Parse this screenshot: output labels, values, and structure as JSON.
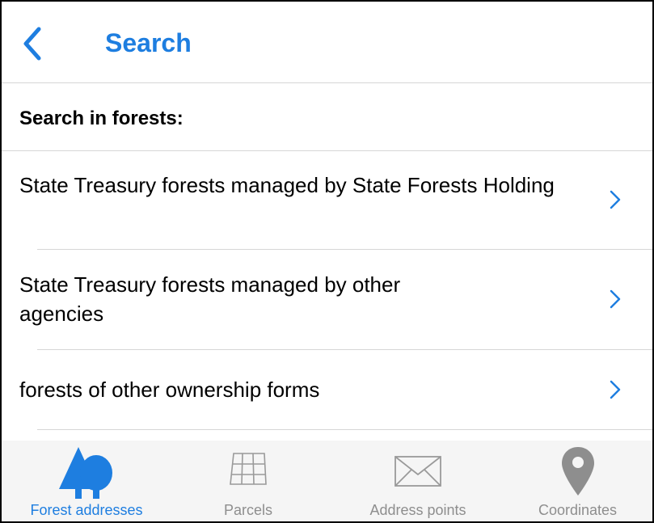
{
  "header": {
    "title": "Search",
    "back_icon": "chevron-left-icon"
  },
  "section": {
    "header_label": "Search in forests:"
  },
  "list": {
    "items": [
      {
        "label": "State Treasury forests managed by State Forests Holding",
        "icon": "chevron-right-icon"
      },
      {
        "label": "State Treasury forests managed by other agencies",
        "icon": "chevron-right-icon"
      },
      {
        "label": "forests of other ownership forms",
        "icon": "chevron-right-icon"
      }
    ]
  },
  "tabs": [
    {
      "label": "Forest addresses",
      "icon": "trees-icon",
      "active": true
    },
    {
      "label": "Parcels",
      "icon": "grid-parcels-icon",
      "active": false
    },
    {
      "label": "Address points",
      "icon": "envelope-icon",
      "active": false
    },
    {
      "label": "Coordinates",
      "icon": "location-pin-icon",
      "active": false
    }
  ],
  "colors": {
    "accent": "#1e7ee0",
    "inactive_tab": "#8e8e8e",
    "separator": "#d6d6d6",
    "tab_bar_bg": "#f5f5f5"
  }
}
